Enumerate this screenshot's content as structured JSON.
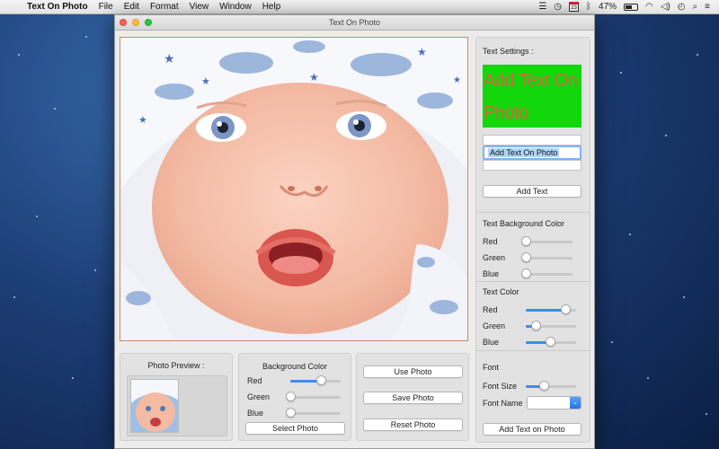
{
  "menubar": {
    "app_name": "Text On Photo",
    "items": [
      "File",
      "Edit",
      "Format",
      "View",
      "Window",
      "Help"
    ],
    "calendar_day": "23",
    "battery_percent": "47%"
  },
  "window": {
    "title": "Text On Photo"
  },
  "preview_panel": {
    "title": "Photo Preview :"
  },
  "background_panel": {
    "title": "Background Color",
    "sliders": [
      {
        "label": "Red",
        "value": 0.6
      },
      {
        "label": "Green",
        "value": 0.0
      },
      {
        "label": "Blue",
        "value": 0.0
      }
    ],
    "select_button": "Select Photo"
  },
  "actions": {
    "use_photo": "Use Photo",
    "save_photo": "Save Photo",
    "reset_photo": "Reset Photo"
  },
  "sidebar": {
    "text_settings_title": "Text Settings :",
    "preview_text": "Add Text On Photo",
    "preview_bg": "#12d70b",
    "preview_color": "#d7643c",
    "text_input_value": "Add Text On Photo",
    "add_text_button": "Add Text",
    "text_bg_title": "Text Background Color",
    "text_bg_sliders": [
      {
        "label": "Red",
        "value": 0.0
      },
      {
        "label": "Green",
        "value": 0.0
      },
      {
        "label": "Blue",
        "value": 0.0
      }
    ],
    "text_color_title": "Text Color",
    "text_color_sliders": [
      {
        "label": "Red",
        "value": 0.78
      },
      {
        "label": "Green",
        "value": 0.2
      },
      {
        "label": "Blue",
        "value": 0.48
      }
    ],
    "font_title": "Font",
    "font_size_label": "Font Size",
    "font_size_value": 0.35,
    "font_name_label": "Font Name",
    "font_name_value": "",
    "add_on_photo_button": "Add Text on Photo"
  },
  "colors": {
    "accent": "#3b8cf0",
    "frame_border": "#c88a6a"
  }
}
